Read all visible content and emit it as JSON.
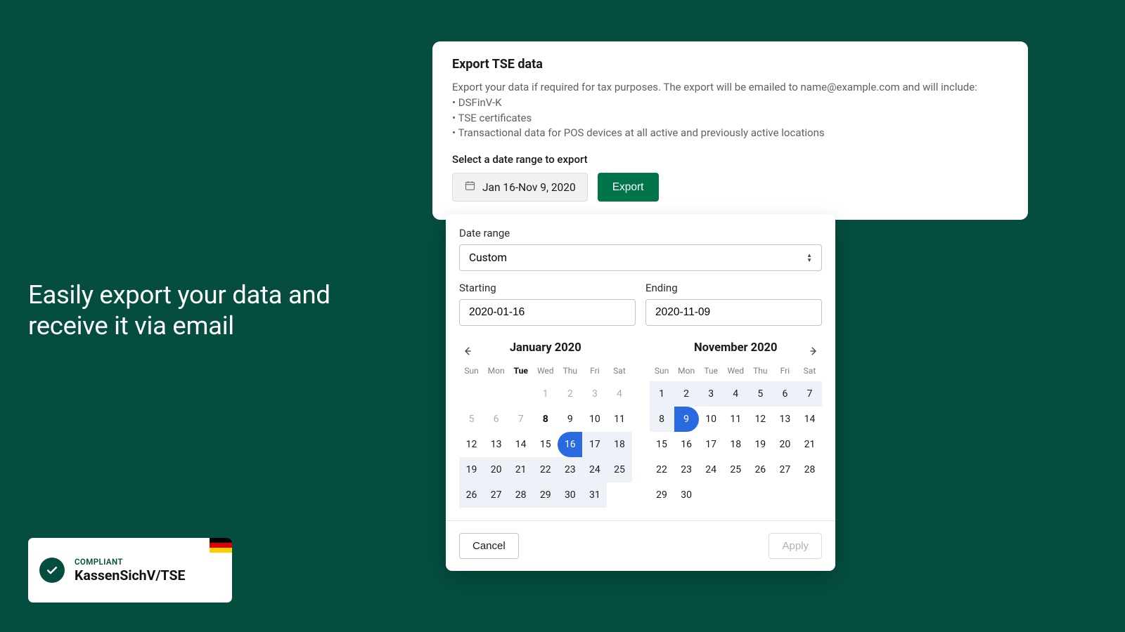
{
  "headline": "Easily export your data and receive it via email",
  "badge": {
    "line1": "COMPLIANT",
    "line2": "KassenSichV/TSE"
  },
  "card": {
    "title": "Export TSE data",
    "desc_intro": "Export your data if required for tax purposes. The export will be emailed to name@example.com and will include:",
    "bullet1": "• DSFinV-K",
    "bullet2": "• TSE certificates",
    "bullet3": "• Transactional data for POS devices at all active and previously active locations",
    "select_label": "Select a date range to export",
    "date_display": "Jan 16-Nov 9, 2020",
    "export_label": "Export"
  },
  "popover": {
    "range_label": "Date range",
    "range_value": "Custom",
    "starting_label": "Starting",
    "starting_value": "2020-01-16",
    "ending_label": "Ending",
    "ending_value": "2020-11-09",
    "cal_left_title": "January 2020",
    "cal_right_title": "November 2020",
    "weekdays": [
      "Sun",
      "Mon",
      "Tue",
      "Wed",
      "Thu",
      "Fri",
      "Sat"
    ],
    "cancel": "Cancel",
    "apply": "Apply"
  }
}
